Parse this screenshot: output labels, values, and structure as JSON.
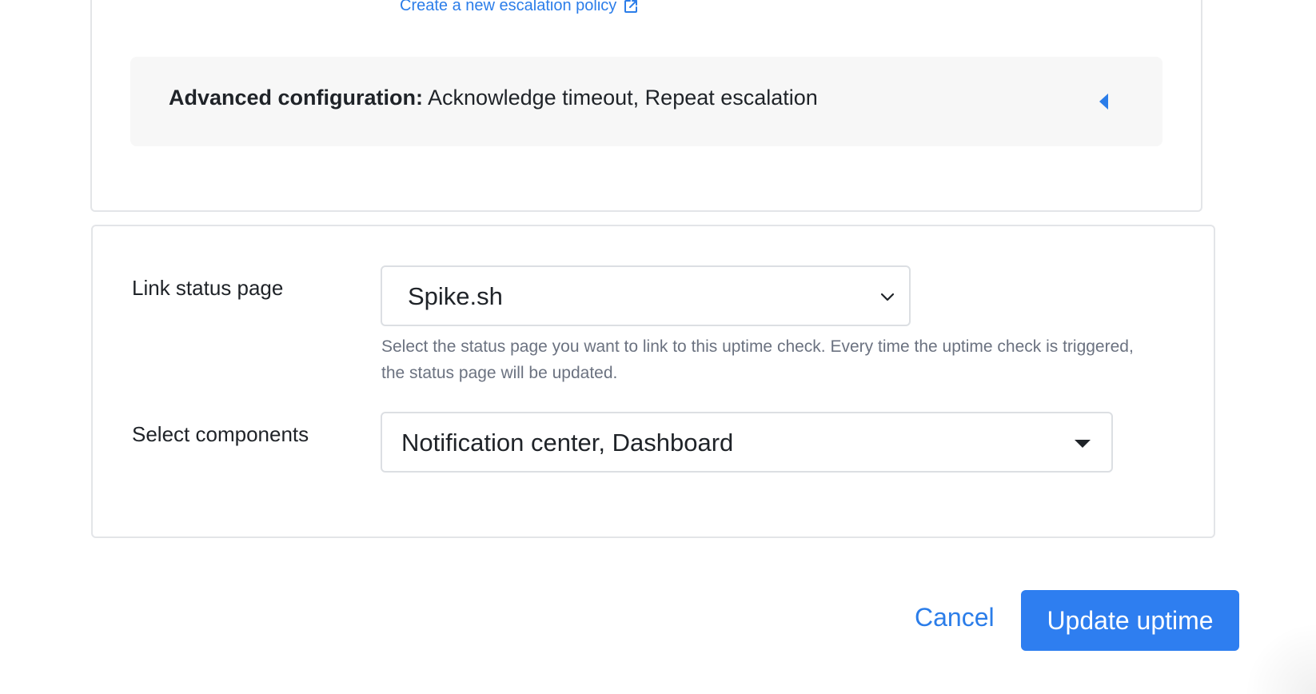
{
  "escalation": {
    "create_link_label": "Create a new escalation policy",
    "link_icon": "external-link-icon"
  },
  "advanced": {
    "label": "Advanced configuration:",
    "value": "Acknowledge timeout, Repeat escalation",
    "toggle_icon": "caret-left-icon"
  },
  "status_page": {
    "label": "Link status page",
    "selected": "Spike.sh",
    "help": "Select the status page you want to link to this uptime check. Every time the uptime check is triggered, the status page will be updated.",
    "dropdown_icon": "chevron-down-icon"
  },
  "components": {
    "label": "Select components",
    "selected": "Notification center, Dashboard",
    "dropdown_icon": "caret-down-icon"
  },
  "actions": {
    "cancel_label": "Cancel",
    "submit_label": "Update uptime"
  },
  "colors": {
    "accent": "#2b7de9",
    "primary_button": "#2e7ef0",
    "panel_background": "#f7f7f7",
    "border": "#e3e5e8",
    "help_text": "#6b7280"
  }
}
